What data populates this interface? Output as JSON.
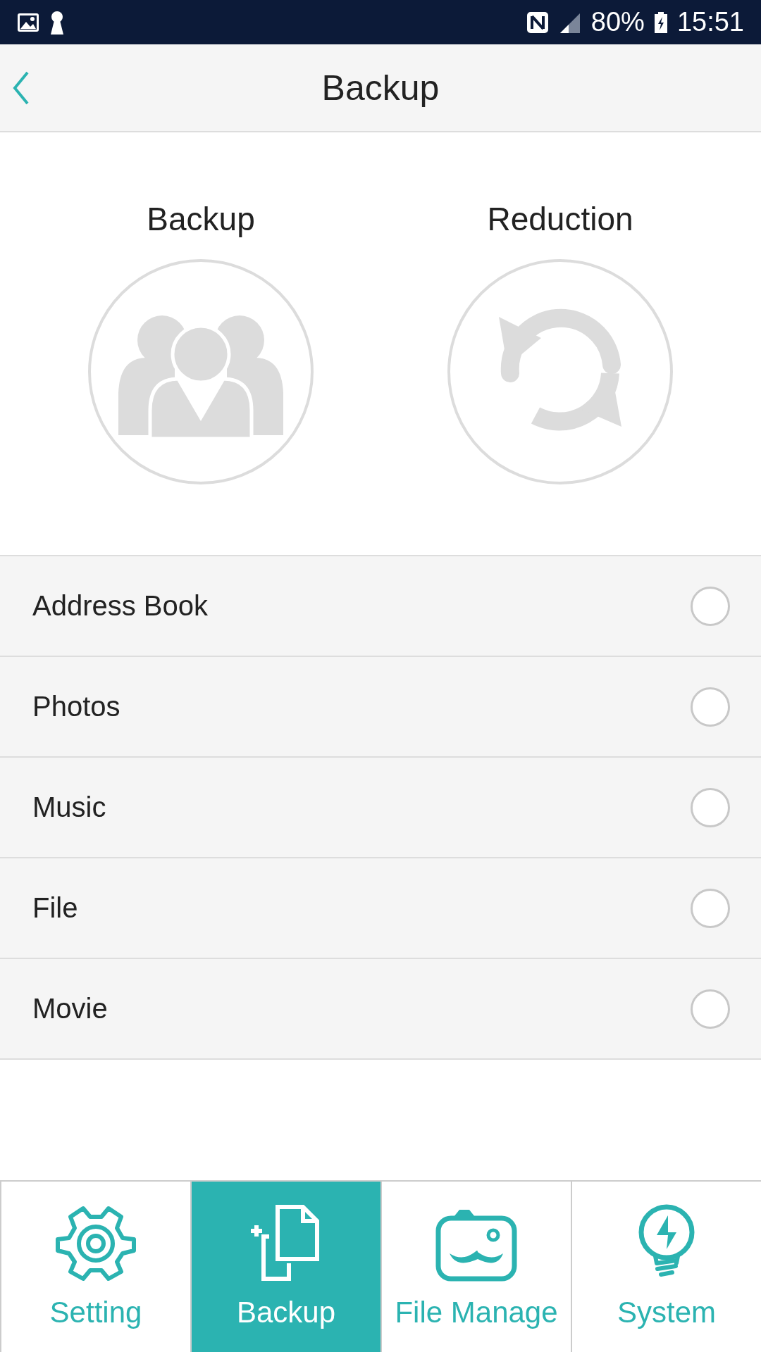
{
  "status_bar": {
    "battery": "80%",
    "time": "15:51"
  },
  "header": {
    "title": "Backup"
  },
  "actions": [
    {
      "label": "Backup",
      "kind": "people"
    },
    {
      "label": "Reduction",
      "kind": "sync"
    }
  ],
  "options": [
    {
      "label": "Address Book",
      "selected": false
    },
    {
      "label": "Photos",
      "selected": false
    },
    {
      "label": "Music",
      "selected": false
    },
    {
      "label": "File",
      "selected": false
    },
    {
      "label": "Movie",
      "selected": false
    }
  ],
  "tabs": [
    {
      "label": "Setting",
      "kind": "gear",
      "selected": false
    },
    {
      "label": "Backup",
      "kind": "copy",
      "selected": true
    },
    {
      "label": "File Manage",
      "kind": "camera",
      "selected": false
    },
    {
      "label": "System",
      "kind": "bulb",
      "selected": false
    }
  ]
}
